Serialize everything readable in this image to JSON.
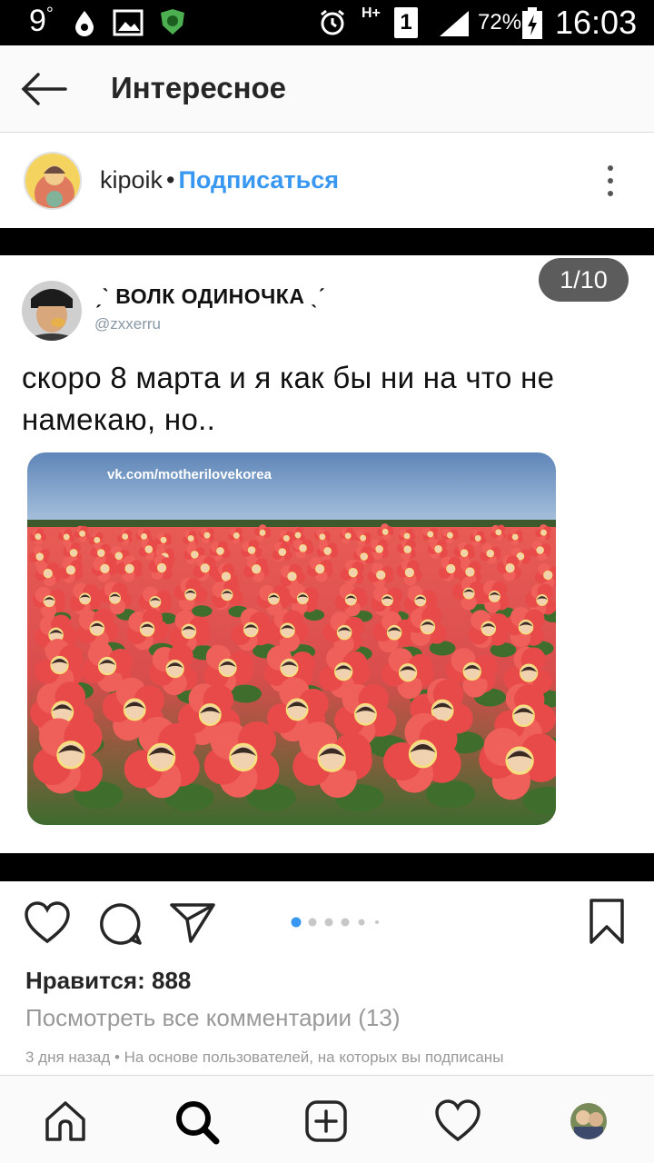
{
  "status_bar": {
    "temperature": "9",
    "temperature_unit": "°",
    "network": "H+",
    "sim": "1",
    "battery_percent": "72%",
    "time": "16:03"
  },
  "header": {
    "title": "Интересное",
    "back_icon": "arrow-left-icon"
  },
  "post": {
    "username": "kipoik",
    "separator": "•",
    "follow_label": "Подписаться",
    "more_icon": "vertical-dots-icon"
  },
  "media": {
    "counter": "1/10",
    "tweet": {
      "display_name": "ˏˋ ВОЛК ОДИНОЧКА ˎˊ",
      "handle": "@zxxerru",
      "text": "скоро 8 марта и я как бы ни на что не намекаю, но..",
      "image_watermark": "vk.com/motherilovekorea"
    }
  },
  "actions": {
    "like_icon": "heart-icon",
    "comment_icon": "comment-icon",
    "share_icon": "paper-plane-icon",
    "save_icon": "bookmark-icon",
    "carousel": {
      "current": 1,
      "visible_dots": 6
    }
  },
  "likes_text": "Нравится: 888",
  "comments_link": "Посмотреть все комментарии (13)",
  "meta_text": "3 дня назад • На основе пользователей, на которых вы подписаны",
  "bottom_nav": {
    "items": [
      "home-icon",
      "search-icon",
      "add-icon",
      "activity-heart-icon",
      "profile-avatar"
    ],
    "active": "search-icon"
  },
  "colors": {
    "accent": "#3897f0",
    "text": "#262626",
    "muted": "#999999",
    "dot_active": "#3897f0",
    "dot_inactive": "#c7c7c7"
  }
}
